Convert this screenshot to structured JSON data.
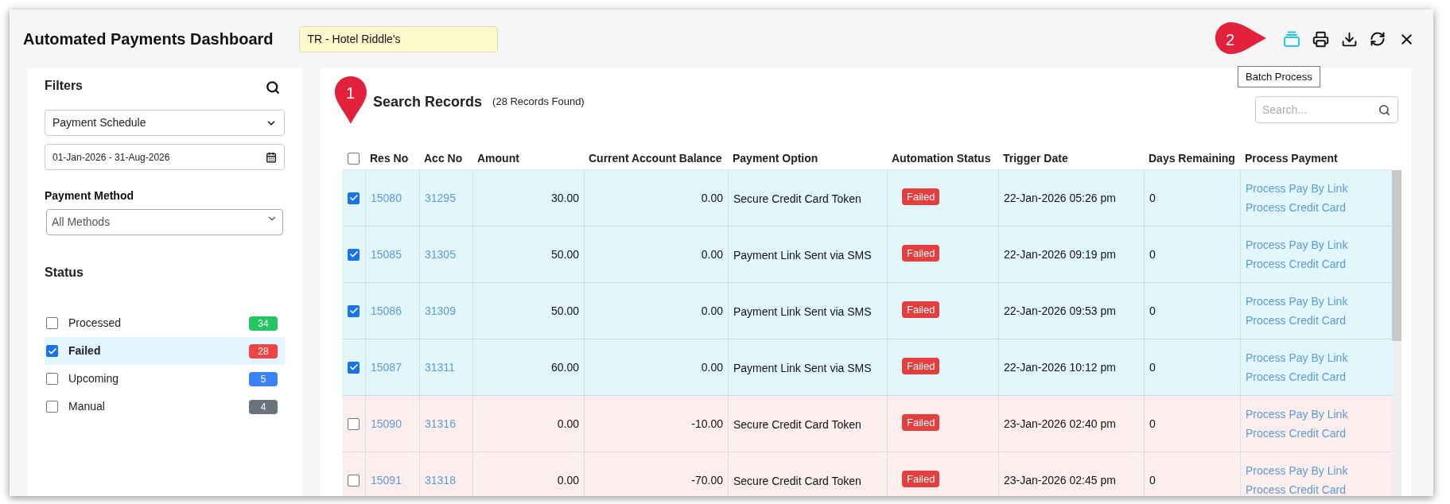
{
  "window": {
    "title": "Automated Payments Dashboard",
    "property": "TR - Hotel Riddle's"
  },
  "toolbar": [
    {
      "kind": "batch",
      "highlighted": true
    },
    {
      "kind": "print",
      "highlighted": false
    },
    {
      "kind": "download",
      "highlighted": false
    },
    {
      "kind": "refresh",
      "highlighted": false
    },
    {
      "kind": "close",
      "highlighted": false
    }
  ],
  "tooltip": "Batch Process",
  "callouts": [
    {
      "label": "1",
      "kind": "down"
    },
    {
      "label": "2",
      "kind": "right"
    }
  ],
  "filters": {
    "title": "Filters",
    "schedule": "Payment Schedule",
    "date_range": "01-Jan-2026 - 31-Aug-2026",
    "payment_method_label": "Payment Method",
    "payment_method": "All Methods",
    "status_title": "Status",
    "statuses": [
      {
        "label": "Processed",
        "count": "34",
        "color": "#22c55e",
        "checked": false,
        "selected": false
      },
      {
        "label": "Failed",
        "count": "28",
        "color": "#ef4444",
        "checked": true,
        "selected": true
      },
      {
        "label": "Upcoming",
        "count": "5",
        "color": "#3b82f6",
        "checked": false,
        "selected": false
      },
      {
        "label": "Manual",
        "count": "4",
        "color": "#6b7280",
        "checked": false,
        "selected": false
      }
    ]
  },
  "records": {
    "title": "Search Records",
    "count": "(28 Records Found)",
    "search_placeholder": "Search...",
    "select_all_checked": false,
    "columns": [
      "Res No",
      "Acc No",
      "Amount",
      "Current Account Balance",
      "Payment Option",
      "Automation Status",
      "Trigger Date",
      "Days Remaining",
      "Process Payment"
    ],
    "rows": [
      {
        "res_no": "15080",
        "acc_no": "31295",
        "amount": "30.00",
        "balance": "0.00",
        "payment_option": "Secure Credit Card Token",
        "status": "Failed",
        "trigger_date": "22-Jan-2026 05:26 pm",
        "days_remaining": "0",
        "actions": [
          "Process Pay By Link",
          "Process Credit Card"
        ],
        "checked": true
      },
      {
        "res_no": "15085",
        "acc_no": "31305",
        "amount": "50.00",
        "balance": "0.00",
        "payment_option": "Payment Link Sent via SMS",
        "status": "Failed",
        "trigger_date": "22-Jan-2026 09:19 pm",
        "days_remaining": "0",
        "actions": [
          "Process Pay By Link",
          "Process Credit Card"
        ],
        "checked": true
      },
      {
        "res_no": "15086",
        "acc_no": "31309",
        "amount": "50.00",
        "balance": "0.00",
        "payment_option": "Payment Link Sent via SMS",
        "status": "Failed",
        "trigger_date": "22-Jan-2026 09:53 pm",
        "days_remaining": "0",
        "actions": [
          "Process Pay By Link",
          "Process Credit Card"
        ],
        "checked": true
      },
      {
        "res_no": "15087",
        "acc_no": "31311",
        "amount": "60.00",
        "balance": "0.00",
        "payment_option": "Payment Link Sent via SMS",
        "status": "Failed",
        "trigger_date": "22-Jan-2026 10:12 pm",
        "days_remaining": "0",
        "actions": [
          "Process Pay By Link",
          "Process Credit Card"
        ],
        "checked": true
      },
      {
        "res_no": "15090",
        "acc_no": "31316",
        "amount": "0.00",
        "balance": "-10.00",
        "payment_option": "Secure Credit Card Token",
        "status": "Failed",
        "trigger_date": "23-Jan-2026 02:40 pm",
        "days_remaining": "0",
        "actions": [
          "Process Pay By Link",
          "Process Credit Card"
        ],
        "checked": false
      },
      {
        "res_no": "15091",
        "acc_no": "31318",
        "amount": "0.00",
        "balance": "-70.00",
        "payment_option": "Secure Credit Card Token",
        "status": "Failed",
        "trigger_date": "23-Jan-2026 02:45 pm",
        "days_remaining": "0",
        "actions": [
          "Process Pay By Link",
          "Process Credit Card"
        ],
        "checked": false
      }
    ]
  }
}
